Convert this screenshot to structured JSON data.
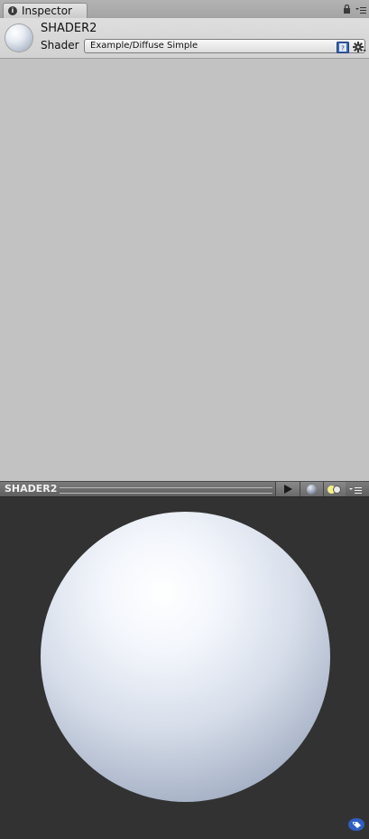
{
  "tab": {
    "icon": "info-icon",
    "label": "Inspector"
  },
  "window_icons": [
    "lock-icon",
    "tab-menu-icon"
  ],
  "material": {
    "name": "SHADER2",
    "thumbnail": "sphere-thumbnail",
    "shader_label": "Shader",
    "shader_value": "Example/Diffuse Simple",
    "icons": [
      "help-book-icon",
      "gear-icon"
    ]
  },
  "preview": {
    "title": "SHADER2",
    "buttons": [
      "play-icon",
      "preview-sphere-icon",
      "light-toggle-icon",
      "menu-icon"
    ],
    "corner_icon": "tag-icon"
  },
  "colors": {
    "panel_bg": "#c2c2c2",
    "preview_bg": "#323232",
    "sphere_highlight": "#ffffff",
    "sphere_shadow": "#7c889d"
  }
}
